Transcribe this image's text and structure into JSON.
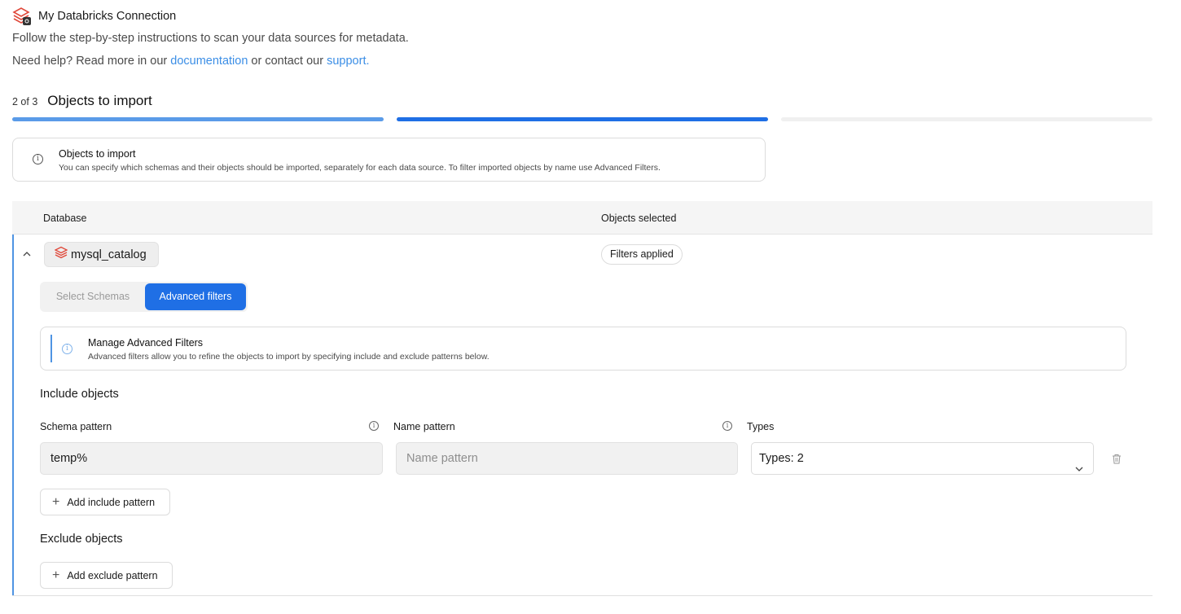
{
  "header": {
    "title": "My Databricks Connection",
    "subtitle": "Follow the step-by-step instructions to scan your data sources for metadata.",
    "help_prefix": "Need help? Read more in our ",
    "help_link_docs": "documentation",
    "help_middle": " or contact our ",
    "help_link_support": "support."
  },
  "step": {
    "count": "2 of 3",
    "title": "Objects to import"
  },
  "info": {
    "title": "Objects to import",
    "description": "You can specify which schemas and their objects should be imported, separately for each data source. To filter imported objects by name use Advanced Filters."
  },
  "table": {
    "col_database": "Database",
    "col_objects": "Objects selected"
  },
  "row": {
    "catalog": "mysql_catalog",
    "status": "Filters applied"
  },
  "tabs": {
    "select_schemas": "Select Schemas",
    "advanced_filters": "Advanced filters"
  },
  "manage": {
    "title": "Manage Advanced Filters",
    "description": "Advanced filters allow you to refine the objects to import by specifying include and exclude patterns below."
  },
  "include": {
    "title": "Include objects",
    "schema_label": "Schema pattern",
    "name_label": "Name pattern",
    "types_label": "Types",
    "schema_value": "temp%",
    "name_placeholder": "Name pattern",
    "types_value": "Types: 2",
    "add_button": "Add include pattern"
  },
  "exclude": {
    "title": "Exclude objects",
    "add_button": "Add exclude pattern"
  },
  "colors": {
    "accent": "#1f6fe5",
    "link": "#3b8ee6",
    "progress_done": "#5a9be8",
    "progress_active": "#1f6fe5",
    "progress_todo": "#f0f0f0",
    "brand_red": "#e0483a"
  }
}
